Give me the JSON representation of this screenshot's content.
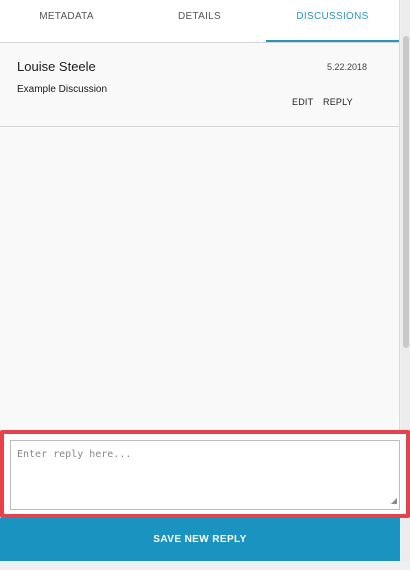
{
  "tabs": [
    {
      "label": "METADATA",
      "active": false
    },
    {
      "label": "DETAILS",
      "active": false
    },
    {
      "label": "DISCUSSIONS",
      "active": true
    }
  ],
  "discussion": {
    "author": "Louise Steele",
    "date": "5.22.2018",
    "text": "Example Discussion",
    "edit_label": "EDIT",
    "reply_label": "REPLY"
  },
  "reply": {
    "value": "",
    "placeholder": "Enter reply here..."
  },
  "save_button_label": "SAVE NEW REPLY",
  "colors": {
    "accent": "#1b93c0",
    "highlight": "#e4434e"
  }
}
